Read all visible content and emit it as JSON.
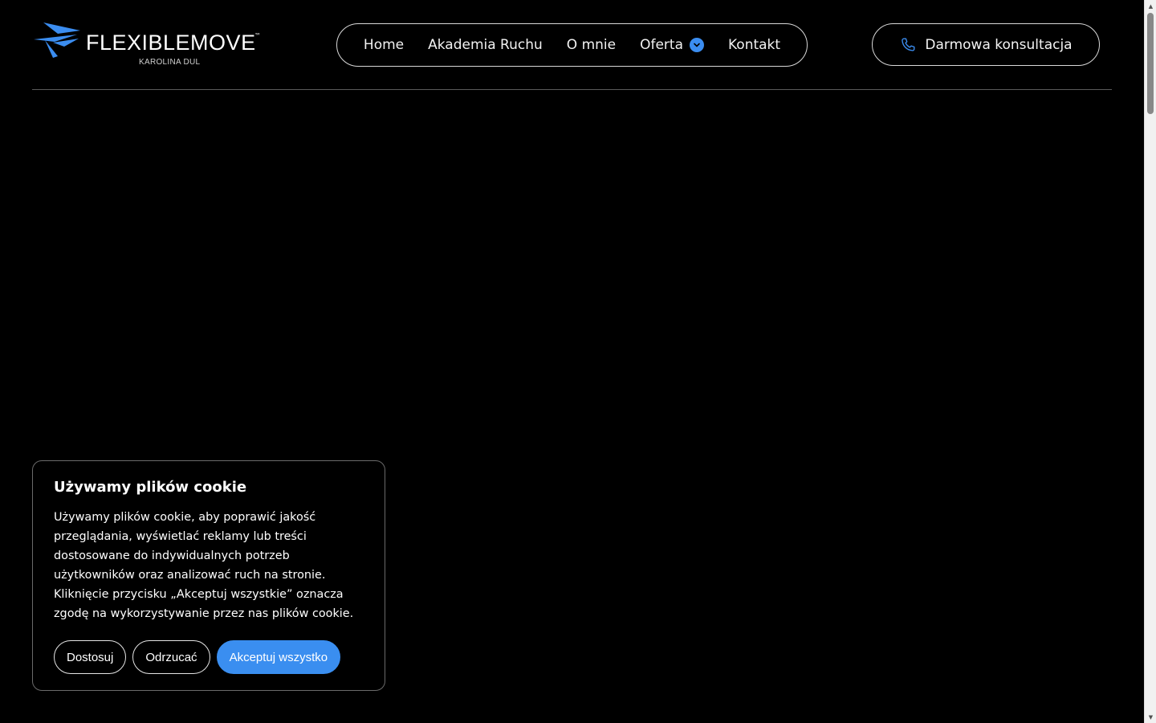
{
  "header": {
    "logo": {
      "name": "FLEXIBLEMOVE",
      "trademark": "™",
      "subtitle": "KAROLINA DUL",
      "accent": "#3b8df0"
    },
    "nav": [
      {
        "label": "Home"
      },
      {
        "label": "Akademia Ruchu"
      },
      {
        "label": "O mnie"
      },
      {
        "label": "Oferta",
        "icon": "chevron-down-icon"
      },
      {
        "label": "Kontakt"
      }
    ],
    "cta": {
      "label": "Darmowa konsultacja",
      "icon": "phone-icon"
    }
  },
  "cookie": {
    "title": "Używamy plików cookie",
    "text": "Używamy plików cookie, aby poprawić jakość przeglądania, wyświetlać reklamy lub treści dostosowane do indywidualnych potrzeb użytkowników oraz analizować ruch na stronie. Kliknięcie przycisku „Akceptuj wszystkie” oznacza zgodę na wykorzystywanie przez nas plików cookie.",
    "buttons": {
      "customize": "Dostosuj",
      "reject": "Odrzucać",
      "accept": "Akceptuj wszystko"
    }
  },
  "colors": {
    "background": "#000000",
    "accent": "#3a8ef0",
    "border": "#d8d8d8"
  }
}
